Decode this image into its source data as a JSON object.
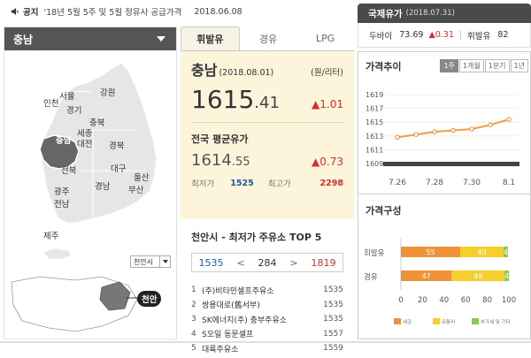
{
  "notice": {
    "label": "공지",
    "text": "'18년 5월 5주 및 5월 정유사 공급가격",
    "date": "2018.06.08"
  },
  "intl": {
    "title": "국제유가",
    "date": "(2018.07.31)",
    "items": [
      {
        "name": "두바이",
        "value": "73.69",
        "change": "▲0.31"
      },
      {
        "name": "휘발유",
        "value": "82"
      }
    ]
  },
  "region_select": {
    "label": "충남"
  },
  "map": {
    "labels": [
      "서울",
      "인천",
      "경기",
      "강원",
      "충북",
      "세종",
      "대전",
      "충남",
      "경북",
      "전북",
      "대구",
      "울산",
      "경남",
      "부산",
      "광주",
      "전남",
      "제주"
    ],
    "selected": "충남",
    "city_select": "천안시",
    "mini_label": "천안"
  },
  "tabs": [
    "휘발유",
    "경유",
    "LPG"
  ],
  "active_tab": "휘발유",
  "price": {
    "region": "충남",
    "date": "(2018.08.01)",
    "unit": "(원/리터)",
    "int": "1615",
    "dec": ".41",
    "change": "▲1.01",
    "avg_title": "전국 평균유가",
    "avg_int": "1614",
    "avg_dec": ".55",
    "avg_change": "▲0.73",
    "min_label": "최저가",
    "min": "1525",
    "max_label": "최고가",
    "max": "2298"
  },
  "top5": {
    "title": "천안시 - 최저가 주유소 TOP 5",
    "low": "1535",
    "mid": "284",
    "high": "1819",
    "prev": "<",
    "next": ">",
    "stations": [
      {
        "no": "1",
        "name": "(주)비타민셀프주유소",
        "price": "1535"
      },
      {
        "no": "2",
        "name": "쌍용대로(舊서부)",
        "price": "1535"
      },
      {
        "no": "3",
        "name": "SK에너지(주) 충부주유소",
        "price": "1535"
      },
      {
        "no": "4",
        "name": "S오일 동문셀프",
        "price": "1557"
      },
      {
        "no": "5",
        "name": "대륙주유소",
        "price": "1559"
      }
    ]
  },
  "trend": {
    "title": "가격추이",
    "periods": [
      "1주",
      "1개월",
      "1분기",
      "1년"
    ],
    "active_period": "1주"
  },
  "composition": {
    "title": "가격구성",
    "legend": [
      "세금",
      "유통비",
      "부가세 및 기타"
    ]
  },
  "chart_data": [
    {
      "type": "line",
      "title": "가격추이",
      "x": [
        "7.26",
        "7.27",
        "7.28",
        "7.29",
        "7.30",
        "7.31",
        "8.1"
      ],
      "x_ticks": [
        "7.26",
        "7.28",
        "7.30",
        "8.1"
      ],
      "values": [
        1612.8,
        1613.2,
        1613.6,
        1613.8,
        1614.0,
        1614.6,
        1615.4
      ],
      "y_ticks": [
        "1619",
        "1617",
        "1615",
        "1613",
        "1611",
        "1609"
      ],
      "ylim": [
        1609,
        1619
      ]
    },
    {
      "type": "bar",
      "title": "가격구성",
      "categories": [
        "휘발유",
        "경유"
      ],
      "series": [
        {
          "name": "세금",
          "values": [
            55,
            47
          ],
          "color": "#f0923a"
        },
        {
          "name": "유통비",
          "values": [
            40,
            49
          ],
          "color": "#f6cf2c"
        },
        {
          "name": "부가세 및 기타",
          "values": [
            4,
            4
          ],
          "color": "#88c94a"
        }
      ],
      "x_ticks": [
        "0",
        "20",
        "40",
        "60",
        "80",
        "100"
      ],
      "xlim": [
        0,
        100
      ]
    }
  ],
  "colors": {
    "accent_red": "#d0312d",
    "accent_blue": "#1e5aa8",
    "panel_beige": "#fdf4dc",
    "header_dark": "#4a4a4a"
  }
}
